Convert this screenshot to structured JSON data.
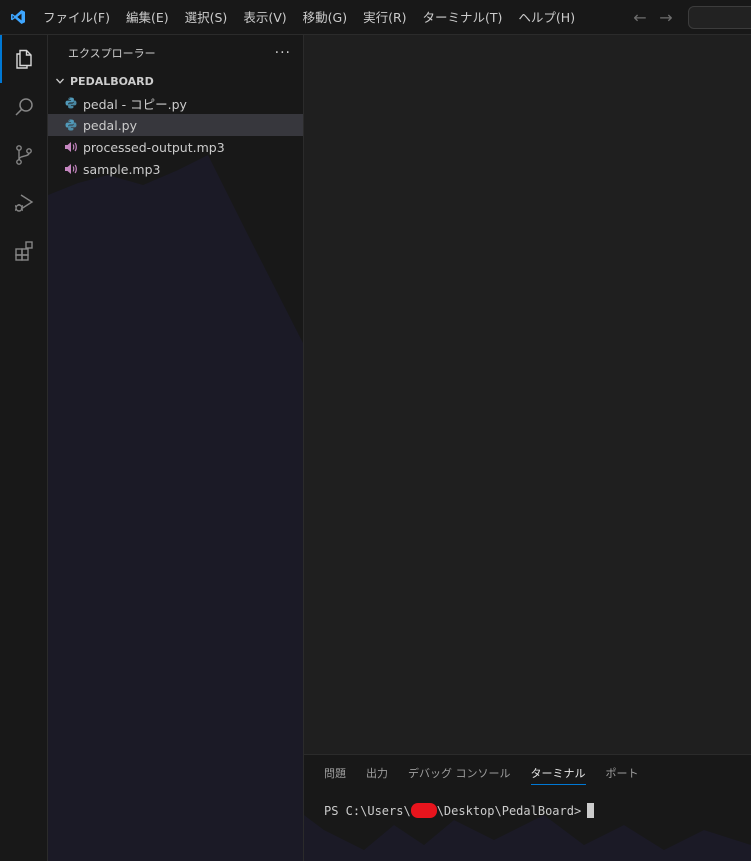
{
  "titlebar": {
    "menu": [
      {
        "label": "ファイル(F)"
      },
      {
        "label": "編集(E)"
      },
      {
        "label": "選択(S)"
      },
      {
        "label": "表示(V)"
      },
      {
        "label": "移動(G)"
      },
      {
        "label": "実行(R)"
      },
      {
        "label": "ターミナル(T)"
      },
      {
        "label": "ヘルプ(H)"
      }
    ],
    "back_icon": "←",
    "forward_icon": "→"
  },
  "activity_bar": {
    "items": [
      {
        "icon": "explorer-icon",
        "active": true
      },
      {
        "icon": "search-icon",
        "active": false
      },
      {
        "icon": "source-control-icon",
        "active": false
      },
      {
        "icon": "run-debug-icon",
        "active": false
      },
      {
        "icon": "extensions-icon",
        "active": false
      }
    ]
  },
  "sidebar": {
    "title": "エクスプローラー",
    "more": "···",
    "folder_name": "PEDALBOARD",
    "files": [
      {
        "name": "pedal - コピー.py",
        "type": "python",
        "selected": false
      },
      {
        "name": "pedal.py",
        "type": "python",
        "selected": true
      },
      {
        "name": "processed-output.mp3",
        "type": "audio",
        "selected": false
      },
      {
        "name": "sample.mp3",
        "type": "audio",
        "selected": false
      }
    ]
  },
  "panel": {
    "tabs": [
      {
        "label": "問題",
        "active": false
      },
      {
        "label": "出力",
        "active": false
      },
      {
        "label": "デバッグ コンソール",
        "active": false
      },
      {
        "label": "ターミナル",
        "active": true
      },
      {
        "label": "ポート",
        "active": false
      }
    ],
    "terminal": {
      "prompt_prefix": "PS C:\\Users\\",
      "prompt_suffix": "\\Desktop\\PedalBoard>"
    }
  },
  "colors": {
    "accent": "#0078d4",
    "python_icon": "#519aba",
    "audio_icon": "#c586c0",
    "redaction": "#e8141d"
  }
}
